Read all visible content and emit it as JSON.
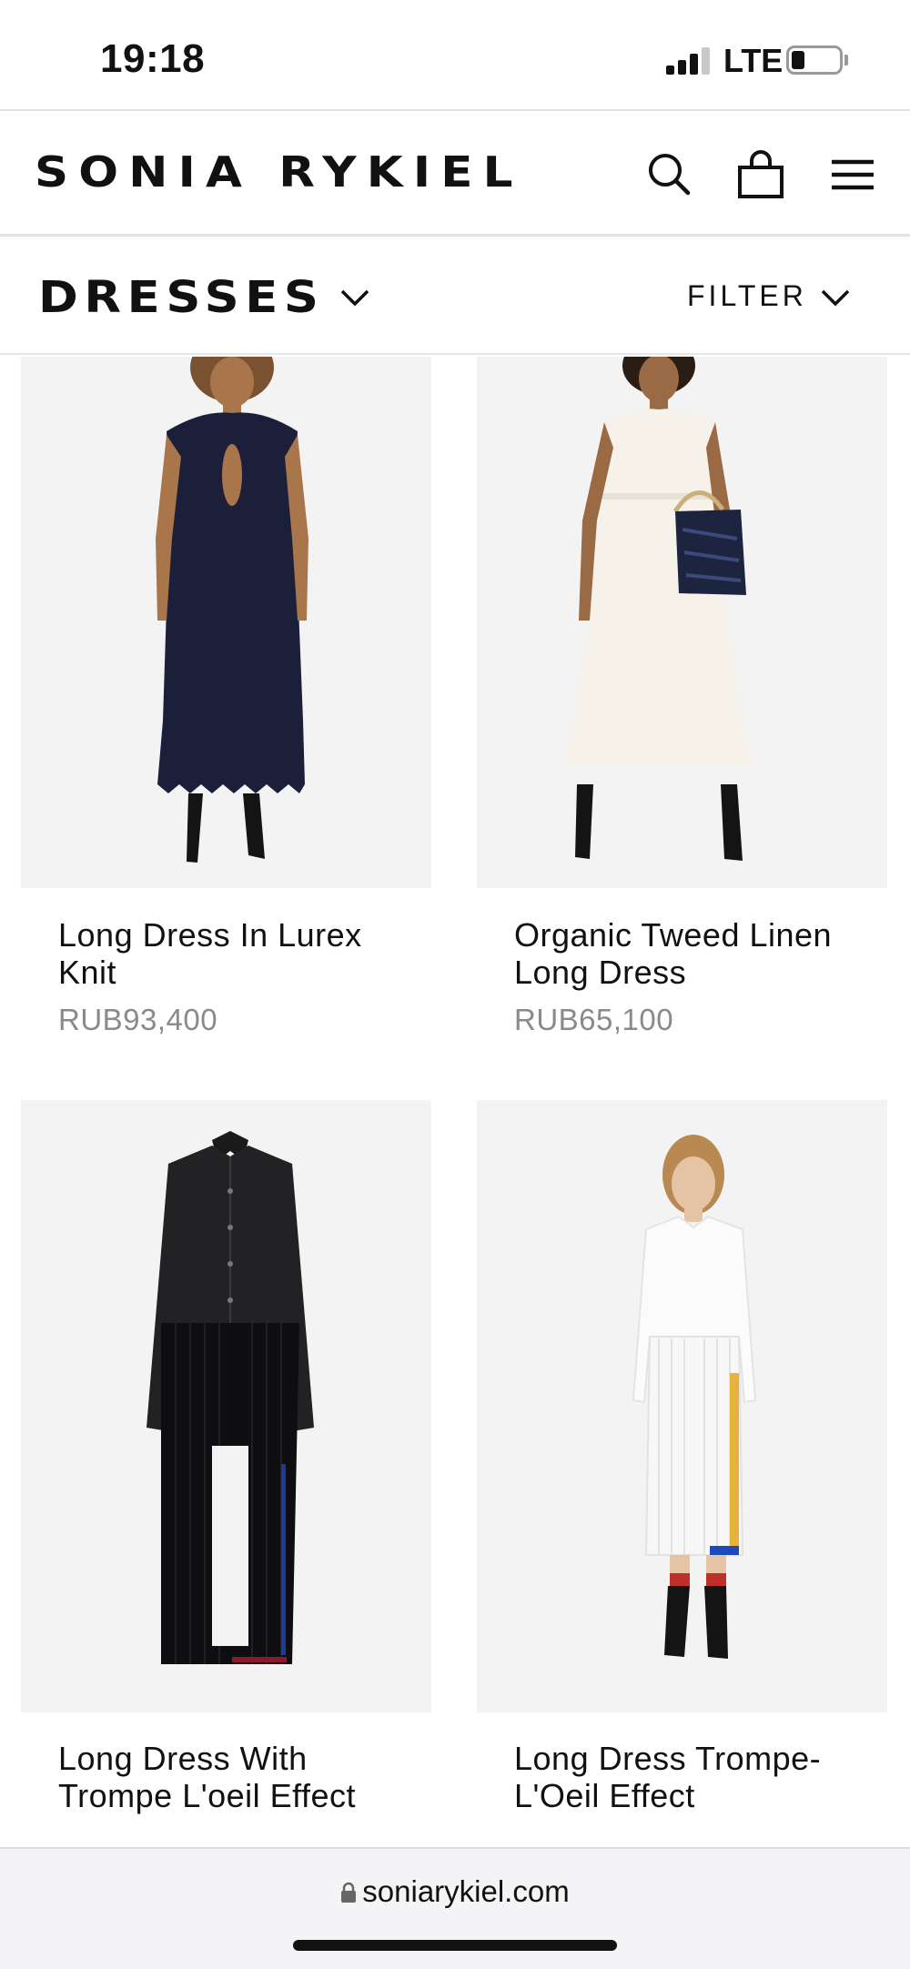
{
  "status_bar": {
    "time": "19:18",
    "network": "LTE",
    "signal_bars_active": 3,
    "battery_level": 0.2
  },
  "header": {
    "brand": "SONIA RYKIEL",
    "icons": [
      "search-icon",
      "shopping-bag-icon",
      "hamburger-menu-icon"
    ]
  },
  "category": {
    "title": "DRESSES",
    "filter_label": "FILTER"
  },
  "products": [
    {
      "name": "Long Dress In Lurex Knit",
      "price": "RUB93,400",
      "image": "navy-lurex-knit-dress-photo"
    },
    {
      "name": "Organic Tweed Linen Long Dress",
      "price": "RUB65,100",
      "image": "white-tweed-dress-with-bag-photo"
    },
    {
      "name": "Long Dress With Trompe L'oeil Effect",
      "price": "",
      "image": "black-shirt-pleated-dress-photo"
    },
    {
      "name": "Long Dress Trompe-L'Oeil Effect",
      "price": "",
      "image": "white-shirt-pleated-dress-photo"
    }
  ],
  "browser": {
    "url": "soniarykiel.com"
  },
  "colors": {
    "text": "#111111",
    "price": "#8a8a8a",
    "image_bg": "#f3f3f3",
    "navy_dress": "#1b1f3a",
    "browser_bar": "#f4f4f6"
  }
}
